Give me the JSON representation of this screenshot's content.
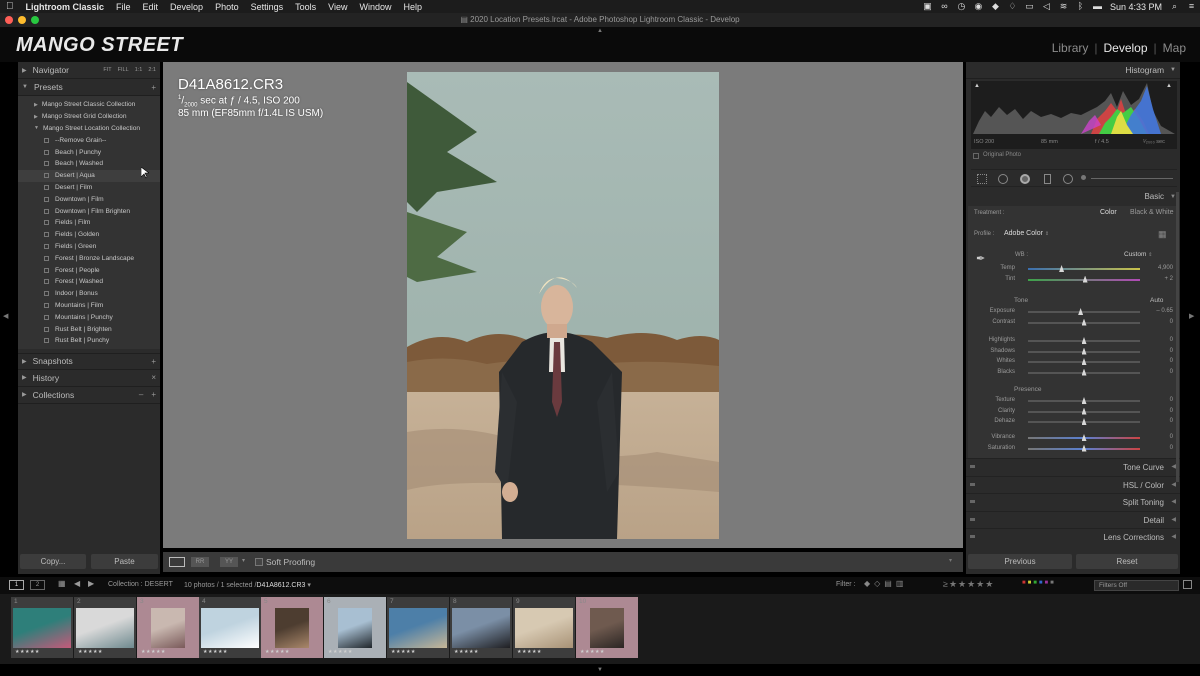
{
  "menubar": {
    "apple": "",
    "items": [
      "Lightroom Classic",
      "File",
      "Edit",
      "Develop",
      "Photo",
      "Settings",
      "Tools",
      "View",
      "Window",
      "Help"
    ],
    "clock": "Sun 4:33 PM"
  },
  "window": {
    "title": "2020 Location Presets.lrcat - Adobe Photoshop Lightroom Classic - Develop"
  },
  "identity": {
    "logo": "MANGO STREET"
  },
  "modules": {
    "library": "Library",
    "develop": "Develop",
    "map": "Map",
    "sep": "|"
  },
  "left": {
    "navigator": {
      "label": "Navigator",
      "fit": "FIT",
      "fill": "FILL",
      "one": "1:1",
      "two": "2:1"
    },
    "presets": {
      "label": "Presets",
      "add": "+",
      "collections": [
        "Mango Street Classic Collection",
        "Mango Street Grid Collection",
        "Mango Street Location Collection"
      ],
      "items": [
        "--Remove Grain--",
        "Beach | Punchy",
        "Beach | Washed",
        "Desert | Aqua",
        "Desert | Film",
        "Downtown | Film",
        "Downtown | Film Brighten",
        "Fields | Film",
        "Fields | Golden",
        "Fields | Green",
        "Forest | Bronze Landscape",
        "Forest | People",
        "Forest | Washed",
        "Indoor | Bonus",
        "Mountains | Film",
        "Mountains | Punchy",
        "Rust Belt | Brighten",
        "Rust Belt | Punchy"
      ]
    },
    "snapshots": {
      "label": "Snapshots",
      "add": "+"
    },
    "history": {
      "label": "History",
      "close": "×"
    },
    "collections": {
      "label": "Collections",
      "minus": "–",
      "add": "+"
    },
    "copy": "Copy...",
    "paste": "Paste"
  },
  "photo_info": {
    "filename": "D41A8612.CR3",
    "exposure_num": "1",
    "exposure_den": "2000",
    "exposure_rest": " sec at ƒ / 4.5, ISO 200",
    "lens": "85 mm (EF85mm f/1.4L IS USM)"
  },
  "toolbar": {
    "soft_proofing": "Soft Proofing"
  },
  "filmbar": {
    "page1": "1",
    "page2": "2",
    "collection": "Collection : DESERT",
    "count": "10 photos / 1 selected /",
    "selected_file": "D41A8612.CR3",
    "filter_label": "Filter :",
    "filters_off": "Filters Off"
  },
  "filmstrip": {
    "cells": [
      {
        "num": "1",
        "stars": "★★★★★"
      },
      {
        "num": "2",
        "stars": "★★★★★"
      },
      {
        "num": "3",
        "stars": "★★★★★"
      },
      {
        "num": "4",
        "stars": "★★★★★"
      },
      {
        "num": "5",
        "stars": "★★★★★"
      },
      {
        "num": "6",
        "stars": "★★★★★"
      },
      {
        "num": "7",
        "stars": "★★★★★"
      },
      {
        "num": "8",
        "stars": "★★★★★"
      },
      {
        "num": "9",
        "stars": "★★★★★"
      },
      {
        "num": "10",
        "stars": "★★★★★"
      }
    ]
  },
  "right": {
    "histogram": {
      "label": "Histogram",
      "iso": "ISO 200",
      "focal": "85 mm",
      "fstop": "f / 4.5",
      "shutter": "¹⁄₂₀₀₀ sec",
      "original": "Original Photo"
    },
    "basic": {
      "label": "Basic",
      "treatment": "Treatment :",
      "color": "Color",
      "bw": "Black & White",
      "profile_label": "Profile :",
      "profile_value": "Adobe Color",
      "wb_label": "WB :",
      "wb_value": "Custom",
      "tone": "Tone",
      "auto": "Auto",
      "presence": "Presence",
      "sliders_top": [
        {
          "label": "Temp",
          "value": "4,900",
          "pos": 0.3
        },
        {
          "label": "Tint",
          "value": "+ 2",
          "pos": 0.51
        }
      ],
      "sliders_tone": [
        {
          "label": "Exposure",
          "value": "– 0.65",
          "pos": 0.47
        },
        {
          "label": "Contrast",
          "value": "0",
          "pos": 0.5
        }
      ],
      "sliders_tone2": [
        {
          "label": "Highlights",
          "value": "0",
          "pos": 0.5
        },
        {
          "label": "Shadows",
          "value": "0",
          "pos": 0.5
        },
        {
          "label": "Whites",
          "value": "0",
          "pos": 0.5
        },
        {
          "label": "Blacks",
          "value": "0",
          "pos": 0.5
        }
      ],
      "sliders_presence": [
        {
          "label": "Texture",
          "value": "0",
          "pos": 0.5
        },
        {
          "label": "Clarity",
          "value": "0",
          "pos": 0.5
        },
        {
          "label": "Dehaze",
          "value": "0",
          "pos": 0.5
        }
      ],
      "sliders_presence2": [
        {
          "label": "Vibrance",
          "value": "0",
          "pos": 0.5
        },
        {
          "label": "Saturation",
          "value": "0",
          "pos": 0.5
        }
      ]
    },
    "sections": [
      "Tone Curve",
      "HSL / Color",
      "Split Toning",
      "Detail",
      "Lens Corrections"
    ],
    "previous": "Previous",
    "reset": "Reset"
  }
}
